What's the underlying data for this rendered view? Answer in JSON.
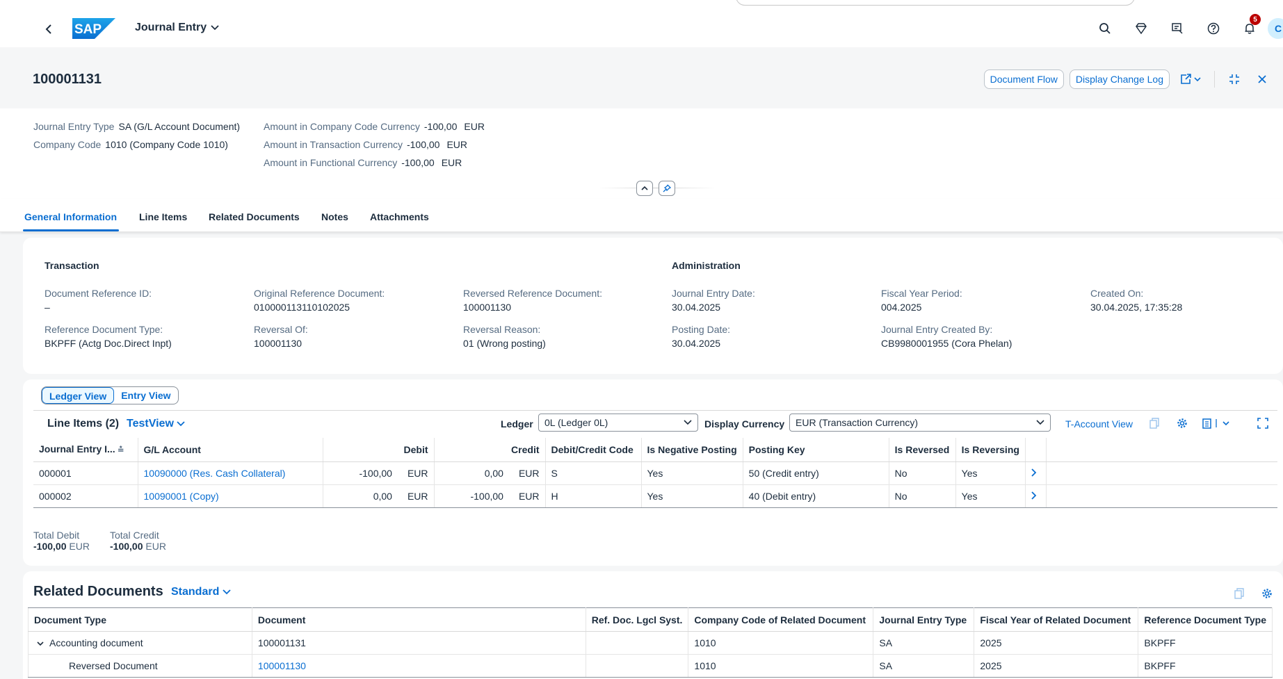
{
  "shell": {
    "app_title": "Journal Entry",
    "notification_count": "5",
    "avatar_initial": "C"
  },
  "header": {
    "title": "100001131",
    "actions": {
      "document_flow": "Document Flow",
      "display_change_log": "Display Change Log"
    },
    "attributes": {
      "journal_entry_type_label": "Journal Entry Type",
      "journal_entry_type_value": "SA (G/L Account Document)",
      "company_code_label": "Company Code",
      "company_code_value": "1010 (Company Code 1010)",
      "amt_cc_label": "Amount in Company Code Currency",
      "amt_cc_value": "-100,00",
      "amt_cc_unit": "EUR",
      "amt_tc_label": "Amount in Transaction Currency",
      "amt_tc_value": "-100,00",
      "amt_tc_unit": "EUR",
      "amt_fc_label": "Amount in Functional Currency",
      "amt_fc_value": "-100,00",
      "amt_fc_unit": "EUR"
    }
  },
  "tabs": [
    "General Information",
    "Line Items",
    "Related Documents",
    "Notes",
    "Attachments"
  ],
  "general": {
    "transaction_title": "Transaction",
    "administration_title": "Administration",
    "doc_ref_id_label": "Document Reference ID:",
    "doc_ref_id_value": "–",
    "orig_ref_doc_label": "Original Reference Document:",
    "orig_ref_doc_value": "010000113110102025",
    "reversed_ref_doc_label": "Reversed Reference Document:",
    "reversed_ref_doc_value": "100001130",
    "ref_doc_type_label": "Reference Document Type:",
    "ref_doc_type_value": "BKPFF (Actg Doc.Direct Inpt)",
    "reversal_of_label": "Reversal Of:",
    "reversal_of_value": "100001130",
    "reversal_reason_label": "Reversal Reason:",
    "reversal_reason_value": "01 (Wrong posting)",
    "je_date_label": "Journal Entry Date:",
    "je_date_value": "30.04.2025",
    "fy_period_label": "Fiscal Year Period:",
    "fy_period_value": "004.2025",
    "created_on_label": "Created On:",
    "created_on_value": "30.04.2025, 17:35:28",
    "posting_date_label": "Posting Date:",
    "posting_date_value": "30.04.2025",
    "created_by_label": "Journal Entry Created By:",
    "created_by_value": "CB9980001955 (Cora Phelan)"
  },
  "line_items": {
    "view_toggle": {
      "ledger": "Ledger View",
      "entry": "Entry View"
    },
    "title": "Line Items (2)",
    "variant": "TestView",
    "ledger_label": "Ledger",
    "ledger_value": "0L (Ledger 0L)",
    "currency_label": "Display Currency",
    "currency_value": "EUR (Transaction Currency)",
    "t_account_view": "T-Account View",
    "columns": [
      "Journal Entry I...",
      "G/L Account",
      "Debit",
      "Credit",
      "Debit/Credit Code",
      "Is Negative Posting",
      "Posting Key",
      "Is Reversed",
      "Is Reversing"
    ],
    "rows": [
      {
        "item": "000001",
        "gl": "10090000 (Res. Cash Collateral)",
        "debit": "-100,00",
        "debit_cur": "EUR",
        "credit": "0,00",
        "credit_cur": "EUR",
        "dc": "S",
        "neg": "Yes",
        "pk": "50 (Credit entry)",
        "rev": "No",
        "reving": "Yes"
      },
      {
        "item": "000002",
        "gl": "10090001 (Copy)",
        "debit": "0,00",
        "debit_cur": "EUR",
        "credit": "-100,00",
        "credit_cur": "EUR",
        "dc": "H",
        "neg": "Yes",
        "pk": "40 (Debit entry)",
        "rev": "No",
        "reving": "Yes"
      }
    ],
    "total_debit_label": "Total Debit",
    "total_debit_value": "-100,00",
    "total_debit_cur": "EUR",
    "total_credit_label": "Total Credit",
    "total_credit_value": "-100,00",
    "total_credit_cur": "EUR"
  },
  "related": {
    "title": "Related Documents",
    "variant": "Standard",
    "columns": [
      "Document Type",
      "Document",
      "Ref. Doc. Lgcl Syst.",
      "Company Code of Related Document",
      "Journal Entry Type",
      "Fiscal Year of Related Document",
      "Reference Document Type"
    ],
    "rows": [
      {
        "type": "Accounting document",
        "doc": "100001131",
        "lgcl": "",
        "cc": "1010",
        "jet": "SA",
        "fy": "2025",
        "rdt": "BKPFF"
      },
      {
        "type": "Reversed Document",
        "doc": "100001130",
        "lgcl": "",
        "cc": "1010",
        "jet": "SA",
        "fy": "2025",
        "rdt": "BKPFF"
      }
    ]
  },
  "colors": {
    "brand": "#0a6ed1",
    "negative": "#bb0000"
  }
}
